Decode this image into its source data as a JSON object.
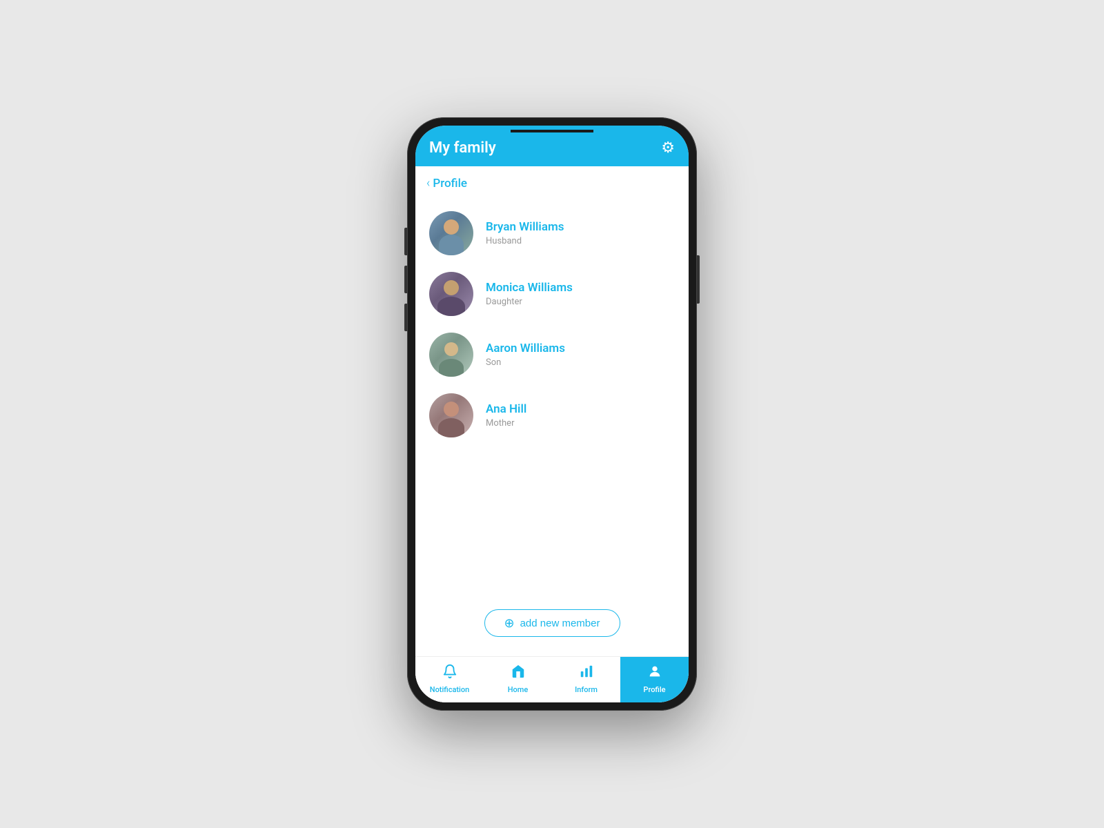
{
  "header": {
    "title": "My family",
    "settings_label": "⚙"
  },
  "back_nav": {
    "label": "Profile",
    "chevron": "‹"
  },
  "members": [
    {
      "name": "Bryan Williams",
      "role": "Husband",
      "avatar_class": "avatar-bryan"
    },
    {
      "name": "Monica Williams",
      "role": "Daughter",
      "avatar_class": "avatar-monica"
    },
    {
      "name": "Aaron Williams",
      "role": "Son",
      "avatar_class": "avatar-aaron"
    },
    {
      "name": "Ana Hill",
      "role": "Mother",
      "avatar_class": "avatar-ana"
    }
  ],
  "add_button": {
    "label": "add new member",
    "icon": "⊕"
  },
  "bottom_nav": [
    {
      "label": "Notification",
      "icon": "🔔",
      "active": false
    },
    {
      "label": "Home",
      "icon": "🏠",
      "active": false
    },
    {
      "label": "Inform",
      "icon": "📊",
      "active": false
    },
    {
      "label": "Profile",
      "icon": "👤",
      "active": true
    }
  ]
}
